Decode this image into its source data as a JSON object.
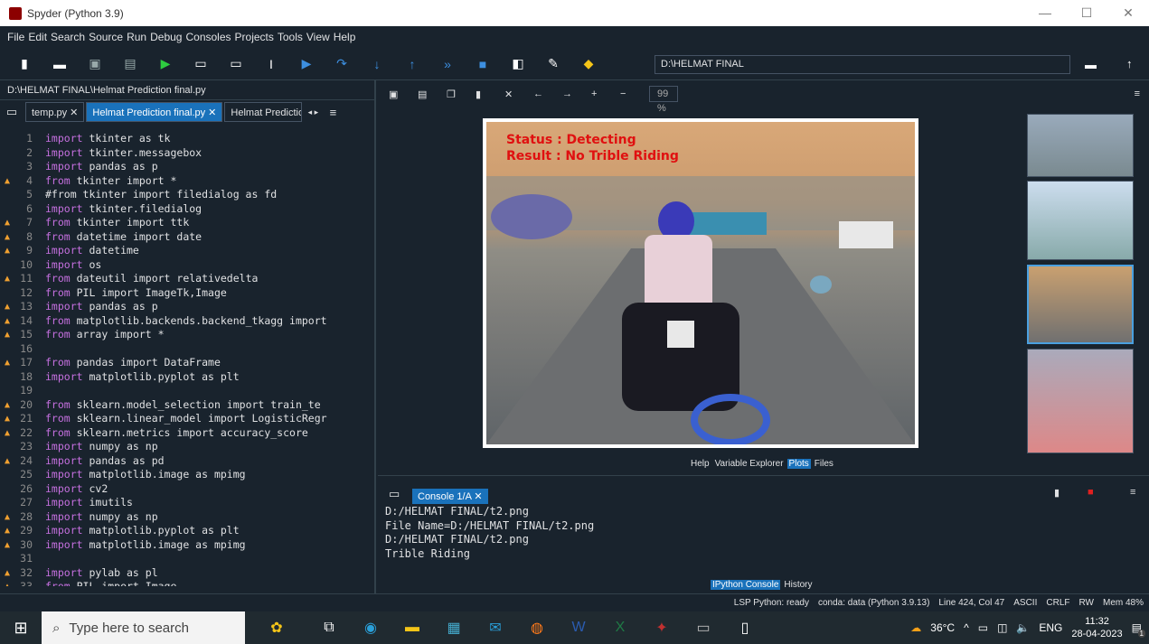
{
  "window": {
    "title": "Spyder (Python 3.9)",
    "controls": [
      "—",
      "☐",
      "✕"
    ]
  },
  "menu": [
    "File",
    "Edit",
    "Search",
    "Source",
    "Run",
    "Debug",
    "Consoles",
    "Projects",
    "Tools",
    "View",
    "Help"
  ],
  "toolbar": {
    "path": "D:\\HELMAT FINAL"
  },
  "editor": {
    "filepath": "D:\\HELMAT FINAL\\Helmat Prediction final.py",
    "tabs": [
      {
        "label": "temp.py ✕",
        "active": false
      },
      {
        "label": "Helmat Prediction final.py ✕",
        "active": true
      },
      {
        "label": "Helmat Prediction fi",
        "active": false
      }
    ],
    "lines": [
      {
        "n": "1",
        "w": false,
        "k": "import",
        "t": " tkinter as tk"
      },
      {
        "n": "2",
        "w": false,
        "k": "import",
        "t": " tkinter.messagebox"
      },
      {
        "n": "3",
        "w": false,
        "k": "import",
        "t": " pandas as p"
      },
      {
        "n": "4",
        "w": true,
        "k": "from",
        "t": " tkinter import *"
      },
      {
        "n": "5",
        "w": false,
        "k": "",
        "t": "#from tkinter import filedialog as fd"
      },
      {
        "n": "6",
        "w": false,
        "k": "import",
        "t": " tkinter.filedialog"
      },
      {
        "n": "7",
        "w": true,
        "k": "from",
        "t": " tkinter import ttk"
      },
      {
        "n": "8",
        "w": true,
        "k": "from",
        "t": " datetime import date"
      },
      {
        "n": "9",
        "w": true,
        "k": "import",
        "t": " datetime"
      },
      {
        "n": "10",
        "w": false,
        "k": "import",
        "t": " os"
      },
      {
        "n": "11",
        "w": true,
        "k": "from",
        "t": " dateutil import relativedelta"
      },
      {
        "n": "12",
        "w": false,
        "k": "from",
        "t": " PIL import ImageTk,Image"
      },
      {
        "n": "13",
        "w": true,
        "k": "import",
        "t": " pandas as p"
      },
      {
        "n": "14",
        "w": true,
        "k": "from",
        "t": " matplotlib.backends.backend_tkagg import"
      },
      {
        "n": "15",
        "w": true,
        "k": "from",
        "t": " array import *"
      },
      {
        "n": "16",
        "w": false,
        "k": "",
        "t": ""
      },
      {
        "n": "17",
        "w": true,
        "k": "from",
        "t": " pandas import DataFrame"
      },
      {
        "n": "18",
        "w": false,
        "k": "import",
        "t": " matplotlib.pyplot as plt"
      },
      {
        "n": "19",
        "w": false,
        "k": "",
        "t": ""
      },
      {
        "n": "20",
        "w": true,
        "k": "from",
        "t": " sklearn.model_selection import train_te"
      },
      {
        "n": "21",
        "w": true,
        "k": "from",
        "t": " sklearn.linear_model import LogisticRegr"
      },
      {
        "n": "22",
        "w": true,
        "k": "from",
        "t": " sklearn.metrics import accuracy_score"
      },
      {
        "n": "23",
        "w": false,
        "k": "import",
        "t": " numpy as np"
      },
      {
        "n": "24",
        "w": true,
        "k": "import",
        "t": " pandas as pd"
      },
      {
        "n": "25",
        "w": false,
        "k": "import",
        "t": " matplotlib.image as mpimg"
      },
      {
        "n": "26",
        "w": false,
        "k": "import",
        "t": " cv2"
      },
      {
        "n": "27",
        "w": false,
        "k": "import",
        "t": " imutils"
      },
      {
        "n": "28",
        "w": true,
        "k": "import",
        "t": " numpy as np"
      },
      {
        "n": "29",
        "w": true,
        "k": "import",
        "t": " matplotlib.pyplot as plt"
      },
      {
        "n": "30",
        "w": true,
        "k": "import",
        "t": " matplotlib.image as mpimg"
      },
      {
        "n": "31",
        "w": false,
        "k": "",
        "t": ""
      },
      {
        "n": "32",
        "w": true,
        "k": "import",
        "t": " pylab as pl"
      },
      {
        "n": "33",
        "w": true,
        "k": "from",
        "t": " PIL import Image"
      }
    ]
  },
  "plots": {
    "zoom": "99 %",
    "image_status": "Status : Detecting",
    "image_result": "Result :  No Trible Riding",
    "pane_tabs": [
      "Help",
      "Variable Explorer",
      "Plots",
      "Files"
    ],
    "active_tab": "Plots"
  },
  "console": {
    "tab": "Console 1/A ✕",
    "output": "D:/HELMAT FINAL/t2.png\nFile Name=D:/HELMAT FINAL/t2.png\nD:/HELMAT FINAL/t2.png\nTrible Riding",
    "pane_tabs": [
      "IPython Console",
      "History"
    ],
    "active_tab": "IPython Console"
  },
  "statusbar": [
    "LSP Python: ready",
    "conda: data (Python 3.9.13)",
    "Line 424, Col 47",
    "ASCII",
    "CRLF",
    "RW",
    "Mem 48%"
  ],
  "taskbar": {
    "search_placeholder": "Type here to search",
    "weather": "36°C",
    "lang": "ENG",
    "time": "11:32",
    "date": "28-04-2023",
    "notif_count": "1"
  },
  "colors": {
    "bg": "#19232d",
    "accent": "#1a72bb",
    "keyword": "#c670e0",
    "warning": "#f0a030",
    "detect_text": "#e01010"
  }
}
